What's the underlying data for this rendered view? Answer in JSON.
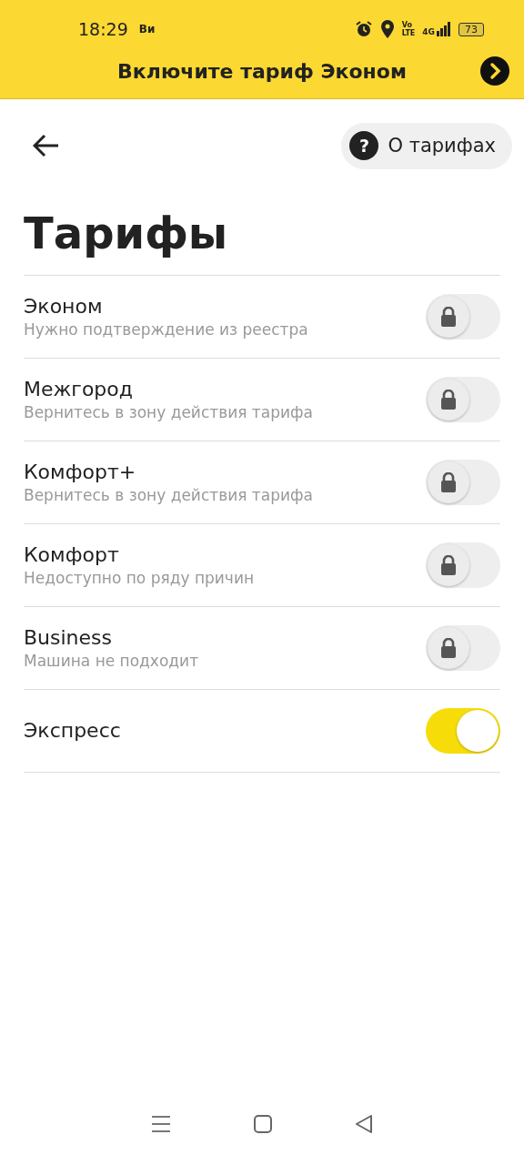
{
  "status_bar": {
    "time": "18:29",
    "carrier": "Ви",
    "volte_top": "Vo",
    "volte_bottom": "LTE",
    "network": "4G",
    "battery": "73"
  },
  "banner": {
    "text": "Включите тариф Эконом"
  },
  "header": {
    "about_button": "О тарифах",
    "help_glyph": "?"
  },
  "title": "Тарифы",
  "tariffs": [
    {
      "name": "Эконом",
      "subtitle": "Нужно подтверждение из реестра",
      "locked": true,
      "on": false
    },
    {
      "name": "Межгород",
      "subtitle": "Вернитесь в зону действия тарифа",
      "locked": true,
      "on": false
    },
    {
      "name": "Комфорт+",
      "subtitle": "Вернитесь в зону действия тарифа",
      "locked": true,
      "on": false
    },
    {
      "name": "Комфорт",
      "subtitle": "Недоступно по ряду причин",
      "locked": true,
      "on": false
    },
    {
      "name": "Business",
      "subtitle": "Машина не подходит",
      "locked": true,
      "on": false
    },
    {
      "name": "Экспресс",
      "locked": false,
      "on": true
    }
  ]
}
